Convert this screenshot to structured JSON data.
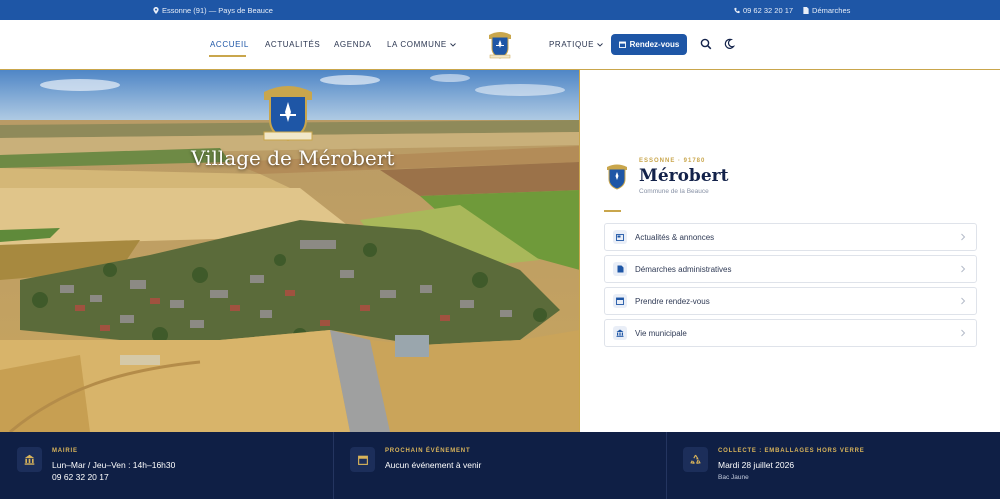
{
  "topbar": {
    "location": "Essonne (91) — Pays de Beauce",
    "phone": "09 62 32 20 17",
    "demarches": "Démarches"
  },
  "nav": {
    "items": [
      {
        "label": "ACCUEIL"
      },
      {
        "label": "ACTUALITÉS"
      },
      {
        "label": "AGENDA"
      },
      {
        "label": "LA COMMUNE"
      },
      {
        "label": "PRATIQUE"
      }
    ],
    "cta": "Rendez-vous"
  },
  "hero": {
    "title": "Village de Mérobert",
    "crest_text": "MARQUE ROBERT · LES MERES MEROBERT"
  },
  "panel": {
    "eyebrow": "ESSONNE · 91780",
    "title": "Mérobert",
    "subtitle": "Commune de la Beauce",
    "links": [
      {
        "label": "Actualités & annonces",
        "icon": "newspaper-icon"
      },
      {
        "label": "Démarches administratives",
        "icon": "document-icon"
      },
      {
        "label": "Prendre rendez-vous",
        "icon": "calendar-icon"
      },
      {
        "label": "Vie municipale",
        "icon": "town-hall-icon"
      }
    ]
  },
  "info": [
    {
      "title": "MAIRIE",
      "line1": "Lun–Mar / Jeu–Ven : 14h–16h30",
      "line2": "09 62 32 20 17",
      "icon": "town-hall-icon"
    },
    {
      "title": "PROCHAIN ÉVÉNEMENT",
      "line1": "Aucun événement à venir",
      "line2": "",
      "icon": "calendar-icon"
    },
    {
      "title": "COLLECTE : EMBALLAGES HORS VERRE",
      "line1": "Mardi 28 juillet 2026",
      "line2": "Bac Jaune",
      "icon": "recycle-icon"
    }
  ],
  "colors": {
    "primary": "#1e56a6",
    "gold": "#c9a64c",
    "navy": "#0f1f45"
  }
}
